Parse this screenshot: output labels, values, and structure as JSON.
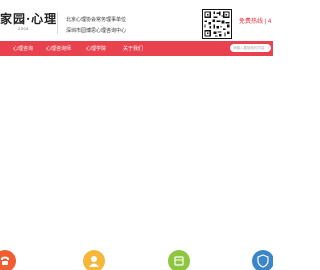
{
  "header": {
    "logo_text": "家园·心理",
    "logo_sub": "2004",
    "org_line1": "北京心理协会常务理事单位",
    "org_line2": "深圳市园博思心理咨询中心",
    "hotline_label": "免费热线 | 4"
  },
  "nav": {
    "items": [
      {
        "label": "心理咨询"
      },
      {
        "label": "心理咨询师"
      },
      {
        "label": "心理学院"
      },
      {
        "label": "关于我们"
      }
    ],
    "search_placeholder": "请输入要搜索的内容"
  },
  "features": {
    "icons": [
      {
        "name": "phone-icon",
        "color": "#f05d33"
      },
      {
        "name": "user-icon",
        "color": "#f5b83a"
      },
      {
        "name": "calendar-icon",
        "color": "#8fc640"
      },
      {
        "name": "shield-icon",
        "color": "#3a86c8"
      }
    ]
  }
}
